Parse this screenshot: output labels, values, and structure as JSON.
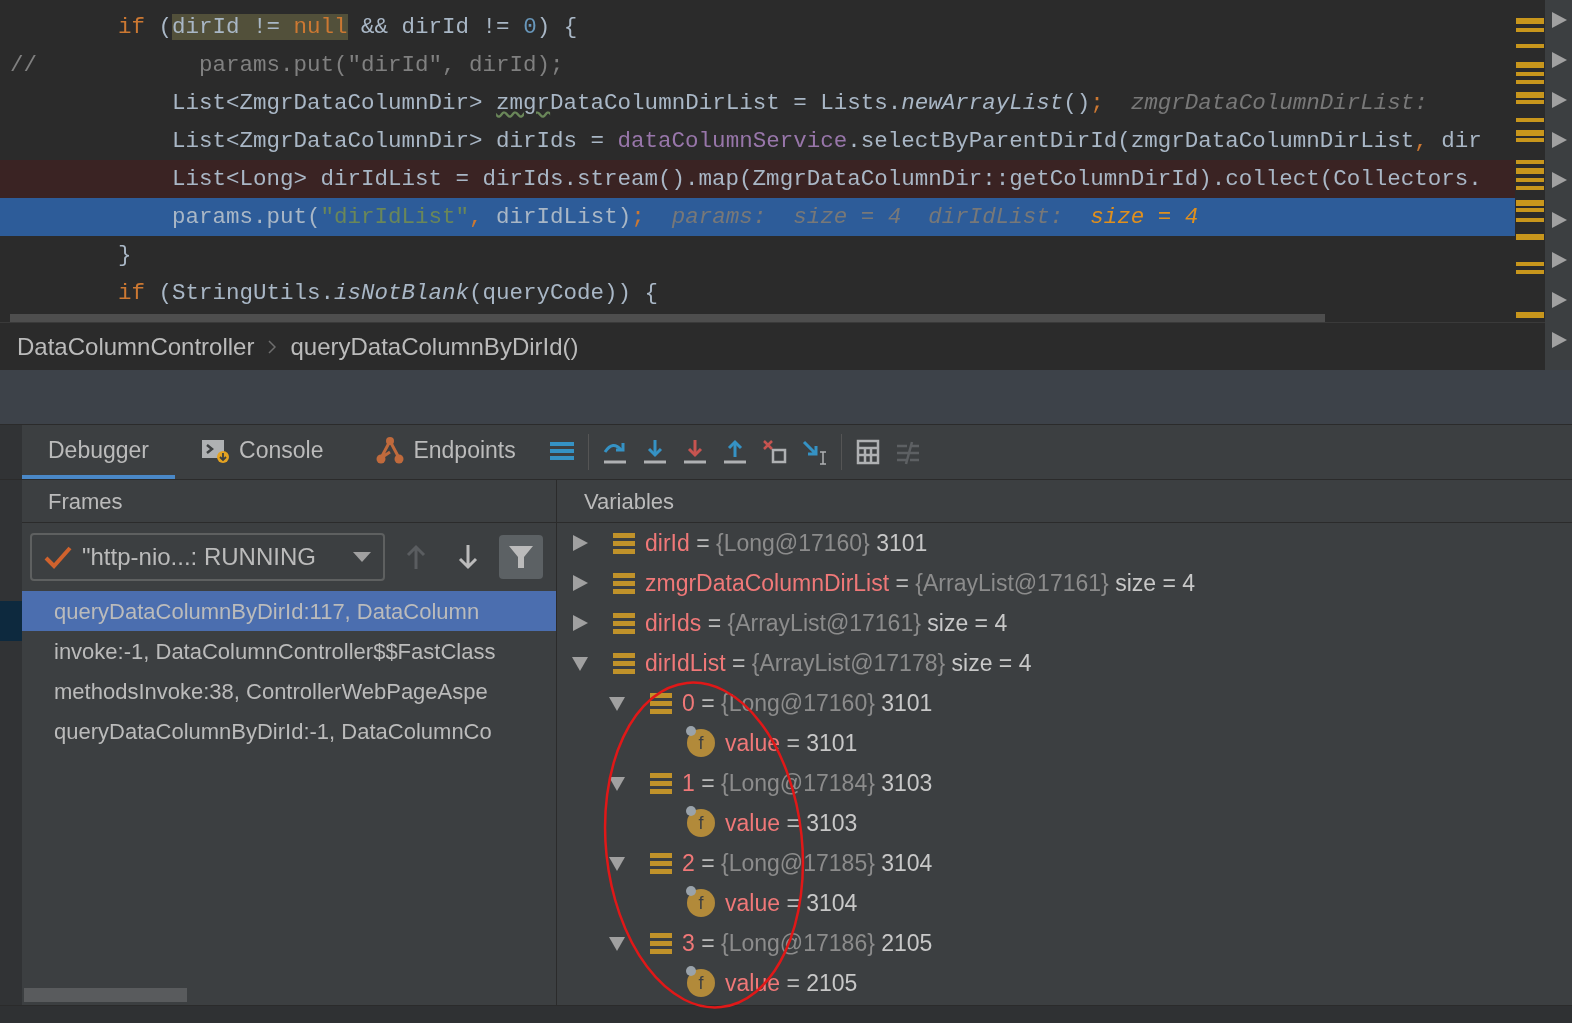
{
  "editor": {
    "lines": [
      {
        "kind": "normal",
        "tokens": [
          {
            "t": "        if",
            "kind": "kw"
          },
          {
            "t": " (",
            "kind": "plain"
          },
          {
            "t": "dirId != ",
            "kind": "match_plain"
          },
          {
            "t": "null",
            "kind": "match_kw"
          },
          {
            "t": " && dirId != ",
            "kind": "plain"
          },
          {
            "t": "0",
            "kind": "num"
          },
          {
            "t": ") {",
            "kind": "plain"
          }
        ]
      },
      {
        "kind": "normal",
        "tokens": [
          {
            "t": "//            params.put(\"dirId\", dirId);",
            "kind": "comment"
          }
        ]
      },
      {
        "kind": "normal",
        "tokens": [
          {
            "t": "            List<ZmgrDataColumnDir> ",
            "kind": "plain"
          },
          {
            "t": "zmgr",
            "kind": "warn"
          },
          {
            "t": "DataColumnDirList = Lists.",
            "kind": "plain"
          },
          {
            "t": "newArrayList",
            "kind": "italic"
          },
          {
            "t": "()",
            "kind": "plain"
          },
          {
            "t": ";",
            "kind": "kw"
          },
          {
            "t": "  zmgrDataColumnDirList:",
            "kind": "hint"
          }
        ]
      },
      {
        "kind": "normal",
        "tokens": [
          {
            "t": "            List<ZmgrDataColumnDir> dirIds = ",
            "kind": "plain"
          },
          {
            "t": "dataColumnService",
            "kind": "field"
          },
          {
            "t": ".selectByParentDirId(zmgrDataColumnDirList",
            "kind": "plain"
          },
          {
            "t": ",",
            "kind": "kw"
          },
          {
            "t": " dir",
            "kind": "plain"
          }
        ]
      },
      {
        "kind": "breakpoint",
        "tokens": [
          {
            "t": "            List<Long> dirIdList = dirIds.stream().map(ZmgrDataColumnDir::getColumnDirId).collect(Collectors.",
            "kind": "plain"
          }
        ]
      },
      {
        "kind": "execution_point",
        "tokens": [
          {
            "t": "            params.put(",
            "kind": "plain"
          },
          {
            "t": "\"dirIdList\"",
            "kind": "str"
          },
          {
            "t": ",",
            "kind": "kw"
          },
          {
            "t": " dirIdList)",
            "kind": "plain"
          },
          {
            "t": ";",
            "kind": "kw"
          },
          {
            "t": "  params:  size = 4  dirIdList:  ",
            "kind": "hint"
          },
          {
            "t": "size = 4",
            "kind": "hint_changed"
          }
        ]
      },
      {
        "kind": "normal",
        "tokens": [
          {
            "t": "        }",
            "kind": "plain"
          }
        ]
      },
      {
        "kind": "normal",
        "tokens": [
          {
            "t": "        if",
            "kind": "kw"
          },
          {
            "t": " (StringUtils.",
            "kind": "plain"
          },
          {
            "t": "isNotBlank",
            "kind": "italic"
          },
          {
            "t": "(queryCode)) {",
            "kind": "plain"
          }
        ]
      }
    ]
  },
  "breadcrumb": [
    "DataColumnController",
    "queryDataColumnByDirId()"
  ],
  "tabs": [
    {
      "kind": "debugger",
      "label": "Debugger",
      "selected": true
    },
    {
      "kind": "console",
      "label": "Console",
      "selected": false
    },
    {
      "kind": "endpoints",
      "label": "Endpoints",
      "selected": false
    }
  ],
  "toolbar": [
    {
      "kind": "layout",
      "disabled": false
    },
    {
      "kind": "step-over",
      "disabled": false
    },
    {
      "kind": "step-into",
      "disabled": false
    },
    {
      "kind": "force-step-into",
      "disabled": false
    },
    {
      "kind": "step-out",
      "disabled": false
    },
    {
      "kind": "drop-frame",
      "disabled": false
    },
    {
      "kind": "run-to-cursor",
      "disabled": false
    },
    {
      "kind": "evaluate",
      "disabled": false
    },
    {
      "kind": "trace",
      "disabled": true
    }
  ],
  "frames": {
    "title": "Frames",
    "thread": "\"http-nio...: RUNNING",
    "up_disabled": true,
    "down_disabled": false,
    "filter_on": true,
    "items": [
      {
        "label": "queryDataColumnByDirId:117, DataColumn",
        "selected": true
      },
      {
        "label": "invoke:-1, DataColumnController$$FastClass",
        "selected": false
      },
      {
        "label": "methodsInvoke:38, ControllerWebPageAspe",
        "selected": false
      },
      {
        "label": "queryDataColumnByDirId:-1, DataColumnCo",
        "selected": false
      }
    ]
  },
  "variables": {
    "title": "Variables",
    "annotation": {
      "kind": "ellipse"
    },
    "items": [
      {
        "kind": "object",
        "name": "dirId",
        "operator": "=",
        "ref": "{Long@17160}",
        "value": "3101",
        "expanded": false
      },
      {
        "kind": "object",
        "name": "zmgrDataColumnDirList",
        "operator": "=",
        "ref": "{ArrayList@17161}",
        "value": "size = 4",
        "expanded": false
      },
      {
        "kind": "object",
        "name": "dirIds",
        "operator": "=",
        "ref": "{ArrayList@17161}",
        "value": "size = 4",
        "expanded": false
      },
      {
        "kind": "object",
        "name": "dirIdList",
        "operator": "=",
        "ref": "{ArrayList@17178}",
        "value": "size = 4",
        "expanded": true,
        "children": [
          {
            "kind": "object",
            "name": "0",
            "operator": "=",
            "ref": "{Long@17160}",
            "value": "3101",
            "expanded": true,
            "children": [
              {
                "kind": "field",
                "icon_letter": "f",
                "name": "value",
                "operator": "=",
                "value": "3101"
              }
            ]
          },
          {
            "kind": "object",
            "name": "1",
            "operator": "=",
            "ref": "{Long@17184}",
            "value": "3103",
            "expanded": true,
            "children": [
              {
                "kind": "field",
                "icon_letter": "f",
                "name": "value",
                "operator": "=",
                "value": "3103"
              }
            ]
          },
          {
            "kind": "object",
            "name": "2",
            "operator": "=",
            "ref": "{Long@17185}",
            "value": "3104",
            "expanded": true,
            "children": [
              {
                "kind": "field",
                "icon_letter": "f",
                "name": "value",
                "operator": "=",
                "value": "3104"
              }
            ]
          },
          {
            "kind": "object",
            "name": "3",
            "operator": "=",
            "ref": "{Long@17186}",
            "value": "2105",
            "expanded": true,
            "children": [
              {
                "kind": "field",
                "icon_letter": "f",
                "name": "value",
                "operator": "=",
                "value": "2105"
              }
            ]
          }
        ]
      }
    ]
  }
}
